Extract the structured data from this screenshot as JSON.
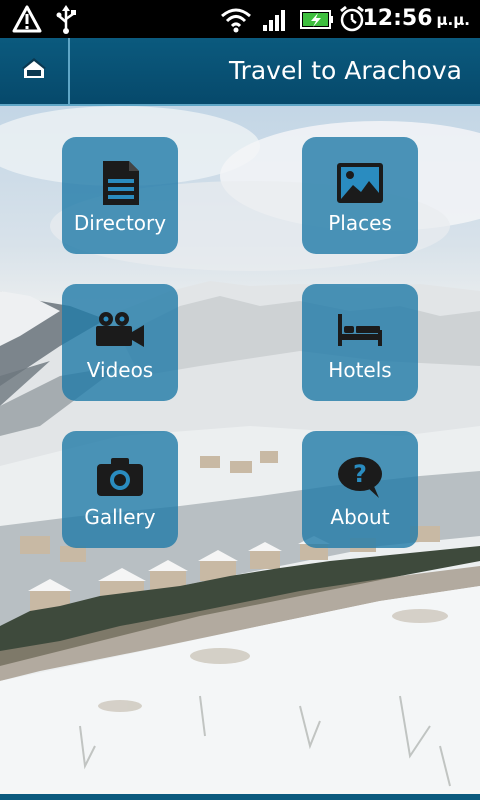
{
  "status_bar": {
    "time": "12:56",
    "ampm": "μ.μ.",
    "icons": [
      "warning-icon",
      "usb-icon",
      "wifi-icon",
      "signal-icon",
      "battery-charging-icon",
      "alarm-icon"
    ]
  },
  "header": {
    "title": "Travel to Arachova",
    "home_icon": "home-icon"
  },
  "menu": {
    "items": [
      {
        "label": "Directory",
        "icon": "document-icon"
      },
      {
        "label": "Places",
        "icon": "picture-icon"
      },
      {
        "label": "Videos",
        "icon": "video-camera-icon"
      },
      {
        "label": "Hotels",
        "icon": "bed-icon"
      },
      {
        "label": "Gallery",
        "icon": "camera-icon"
      },
      {
        "label": "About",
        "icon": "question-bubble-icon"
      }
    ]
  },
  "colors": {
    "header_bg": "#0b5a7e",
    "tile_bg": "#207aa7",
    "divider": "#5fa6c6"
  }
}
